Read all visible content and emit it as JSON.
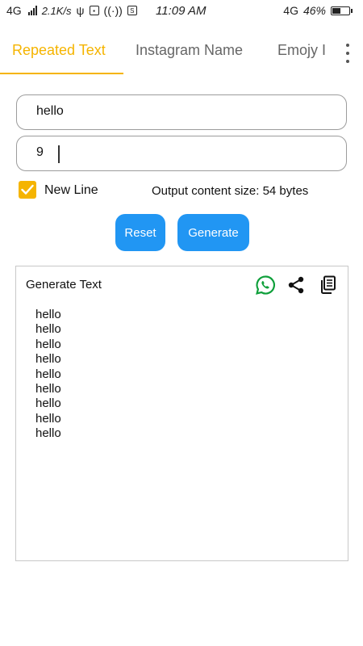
{
  "status_bar": {
    "network": "4G",
    "speed": "2.1K/s",
    "time": "11:09 AM",
    "right_network": "4G",
    "battery": "46%",
    "battery_level": 0.46
  },
  "tabs": [
    {
      "label": "Repeated Text",
      "active": true
    },
    {
      "label": "Instagram Name",
      "active": false
    },
    {
      "label": "Emojy I",
      "active": false
    }
  ],
  "form": {
    "text_value": "hello",
    "count_value": "9",
    "new_line_label": "New Line",
    "new_line_checked": true,
    "output_size": "Output content size: 54 bytes"
  },
  "buttons": {
    "reset_label": "Reset",
    "generate_label": "Generate"
  },
  "result": {
    "title": "Generate Text",
    "lines": [
      "hello",
      "hello",
      "hello",
      "hello",
      "hello",
      "hello",
      "hello",
      "hello",
      "hello"
    ]
  },
  "colors": {
    "accent": "#F5B400",
    "button": "#2196F3",
    "whatsapp": "#0E9F3A"
  },
  "icons": [
    "whatsapp-icon",
    "share-icon",
    "copy-icon"
  ]
}
